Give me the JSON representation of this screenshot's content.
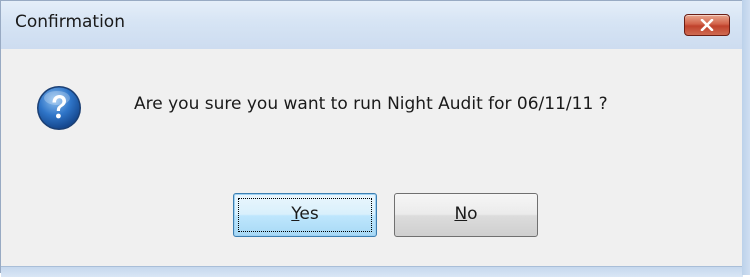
{
  "window": {
    "title": "Confirmation"
  },
  "dialog": {
    "icon": "question-icon",
    "message": "Are you sure you want to run Night Audit for 06/11/11 ?"
  },
  "buttons": {
    "yes": {
      "mnemonic": "Y",
      "rest": "es"
    },
    "no": {
      "mnemonic": "N",
      "rest": "o"
    }
  },
  "colors": {
    "titlebar": "#d6e4f4",
    "close_button": "#c0422c",
    "dialog_background": "#f0f0f0",
    "icon_blue": "#1e5fb0"
  }
}
